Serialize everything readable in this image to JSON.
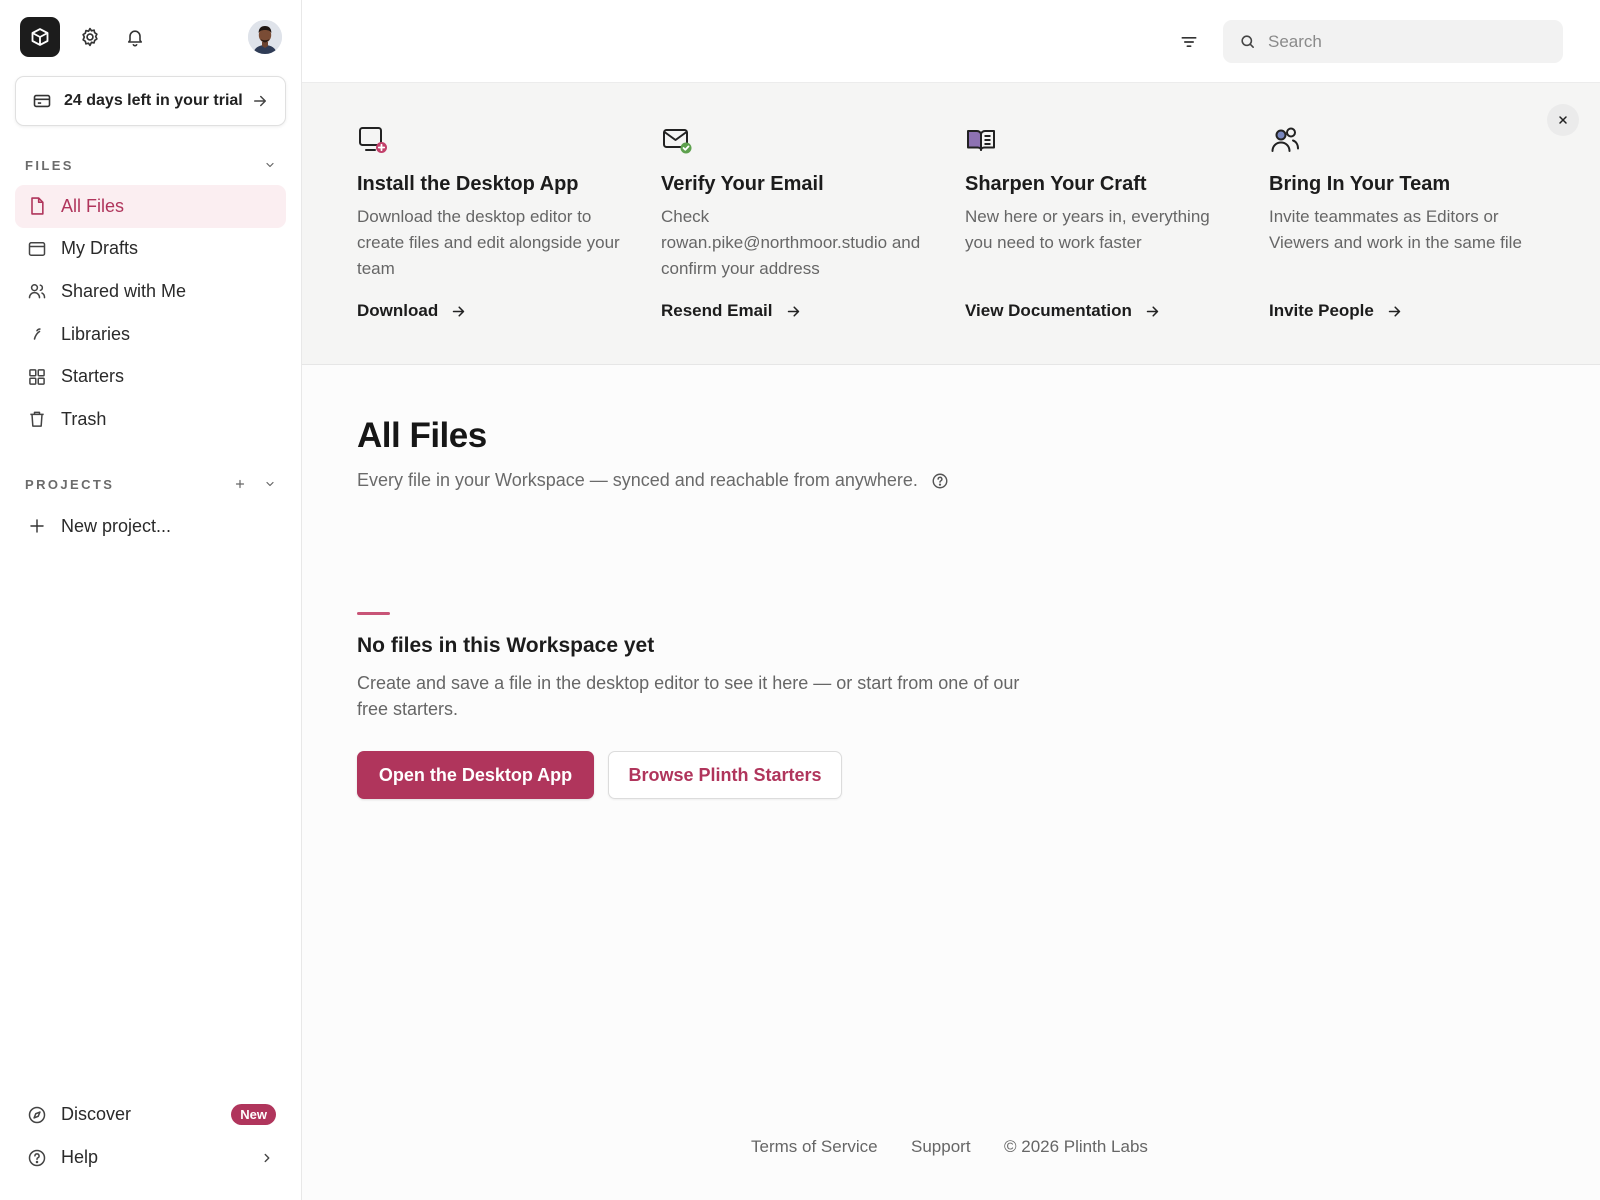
{
  "colors": {
    "accent": "#b0355c",
    "accent_bg": "#fbeef1",
    "sidebar_bg": "#ffffff",
    "banner_bg": "#f5f5f4"
  },
  "sidebar": {
    "trial_text": "24 days left in your trial",
    "files_section": "FILES",
    "projects_section": "PROJECTS",
    "items": [
      {
        "label": "All Files",
        "icon": "file-icon",
        "active": true
      },
      {
        "label": "My Drafts",
        "icon": "drafts-icon"
      },
      {
        "label": "Shared with Me",
        "icon": "people-icon"
      },
      {
        "label": "Libraries",
        "icon": "libraries-icon"
      },
      {
        "label": "Starters",
        "icon": "grid-icon"
      },
      {
        "label": "Trash",
        "icon": "trash-icon"
      }
    ],
    "new_project": "New project...",
    "discover": "Discover",
    "discover_badge": "New",
    "help": "Help"
  },
  "topbar": {
    "search_placeholder": "Search"
  },
  "banner": {
    "cards": [
      {
        "title": "Install the Desktop App",
        "desc": "Download the desktop editor to create files and edit alongside your team",
        "link": "Download",
        "icon": "desktop-plus-icon"
      },
      {
        "title": "Verify Your Email",
        "desc": "Check rowan.pike@northmoor.studio and confirm your address",
        "link": "Resend Email",
        "icon": "mail-check-icon"
      },
      {
        "title": "Sharpen Your Craft",
        "desc": "New here or years in, everything you need to work faster",
        "link": "View Documentation",
        "icon": "book-icon"
      },
      {
        "title": "Bring In Your Team",
        "desc": "Invite teammates as Editors or Viewers and work in the same file",
        "link": "Invite People",
        "icon": "team-icon"
      }
    ]
  },
  "main": {
    "title": "All Files",
    "subtitle": "Every file in your Workspace — synced and reachable from anywhere.",
    "empty_title": "No files in this Workspace yet",
    "empty_desc": "Create and save a file in the desktop editor to see it here — or start from one of our free starters.",
    "primary_button": "Open the Desktop App",
    "secondary_button": "Browse Plinth Starters"
  },
  "footer": {
    "terms": "Terms of Service",
    "support": "Support",
    "copyright": "© 2026 Plinth Labs"
  }
}
